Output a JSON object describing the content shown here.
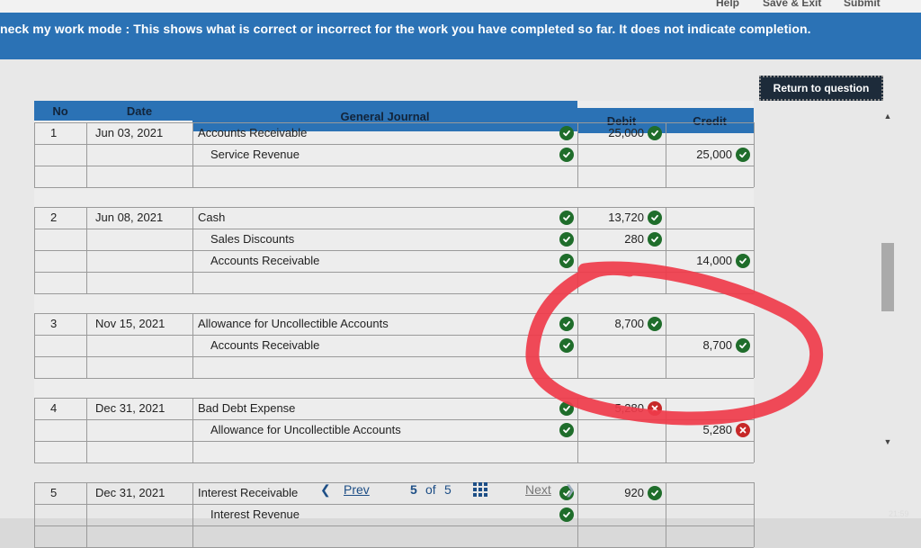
{
  "header": {
    "help": "Help",
    "save_exit": "Save & Exit",
    "submit": "Submit",
    "banner": "neck my work mode : This shows what is correct or incorrect for the work you have completed so far. It does not indicate completion."
  },
  "return_button": "Return to question",
  "table": {
    "headers": {
      "no": "No",
      "date": "Date",
      "journal": "General Journal",
      "debit": "Debit",
      "credit": "Credit"
    },
    "entries": [
      {
        "no": "1",
        "date": "Jun 03, 2021",
        "lines": [
          {
            "account": "Accounts Receivable",
            "debit": "25,000",
            "debit_mark": "correct",
            "credit": "",
            "credit_mark": "",
            "acct_mark": "correct"
          },
          {
            "account": "Service Revenue",
            "debit": "",
            "debit_mark": "",
            "credit": "25,000",
            "credit_mark": "correct",
            "acct_mark": "correct"
          }
        ]
      },
      {
        "no": "2",
        "date": "Jun 08, 2021",
        "lines": [
          {
            "account": "Cash",
            "debit": "13,720",
            "debit_mark": "correct",
            "credit": "",
            "credit_mark": "",
            "acct_mark": "correct"
          },
          {
            "account": "Sales Discounts",
            "debit": "280",
            "debit_mark": "correct",
            "credit": "",
            "credit_mark": "",
            "acct_mark": "correct"
          },
          {
            "account": "Accounts Receivable",
            "debit": "",
            "debit_mark": "",
            "credit": "14,000",
            "credit_mark": "correct",
            "acct_mark": "correct"
          }
        ]
      },
      {
        "no": "3",
        "date": "Nov 15, 2021",
        "lines": [
          {
            "account": "Allowance for Uncollectible Accounts",
            "debit": "8,700",
            "debit_mark": "correct",
            "credit": "",
            "credit_mark": "",
            "acct_mark": "correct"
          },
          {
            "account": "Accounts Receivable",
            "debit": "",
            "debit_mark": "",
            "credit": "8,700",
            "credit_mark": "correct",
            "acct_mark": "correct"
          }
        ]
      },
      {
        "no": "4",
        "date": "Dec 31, 2021",
        "lines": [
          {
            "account": "Bad Debt Expense",
            "debit": "5,280",
            "debit_mark": "incorrect",
            "credit": "",
            "credit_mark": "",
            "acct_mark": "correct"
          },
          {
            "account": "Allowance for Uncollectible Accounts",
            "debit": "",
            "debit_mark": "",
            "credit": "5,280",
            "credit_mark": "incorrect",
            "acct_mark": "correct"
          }
        ]
      },
      {
        "no": "5",
        "date": "Dec 31, 2021",
        "lines": [
          {
            "account": "Interest Receivable",
            "debit": "920",
            "debit_mark": "correct",
            "credit": "",
            "credit_mark": "",
            "acct_mark": "correct"
          },
          {
            "account": "Interest Revenue",
            "debit": "",
            "debit_mark": "",
            "credit": "",
            "credit_mark": "",
            "acct_mark": "correct"
          }
        ]
      }
    ]
  },
  "pagination": {
    "prev": "Prev",
    "current": "5",
    "of_label": "of",
    "total": "5",
    "next": "Next"
  },
  "clock": "21:59",
  "colors": {
    "banner": "#2b72b5",
    "correct": "#1f6d2b",
    "incorrect": "#c62828",
    "annotation": "#ef3b4a"
  }
}
